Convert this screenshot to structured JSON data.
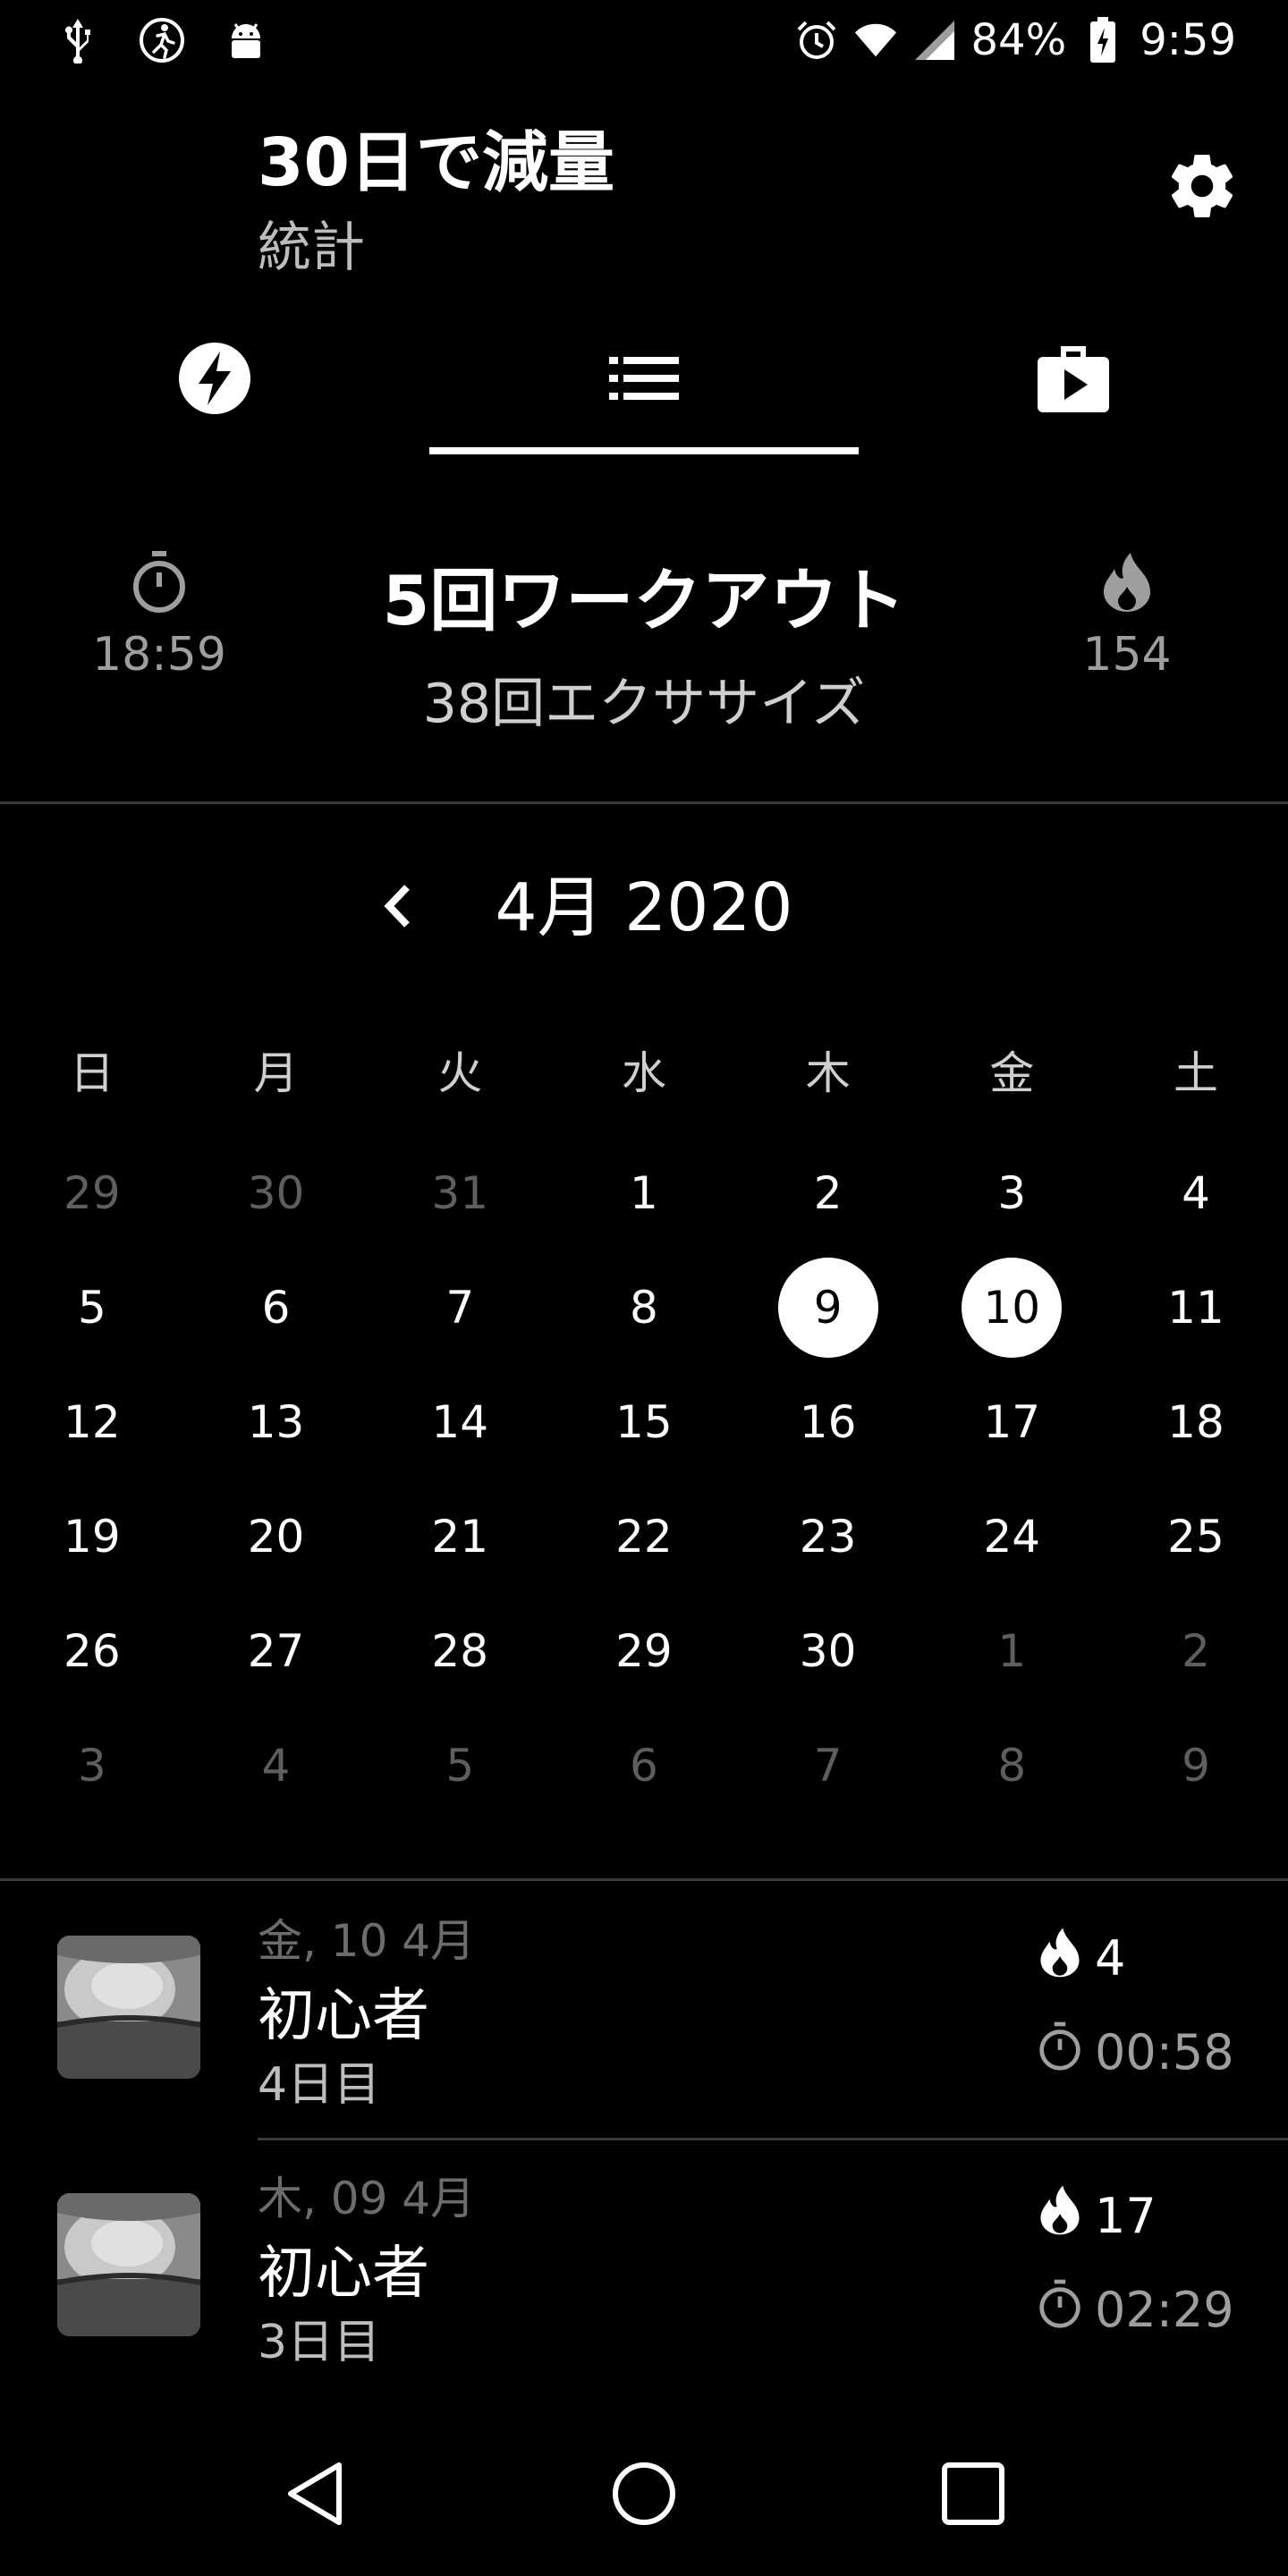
{
  "status_bar": {
    "battery": "84%",
    "time": "9:59",
    "left_icons": [
      "usb-icon",
      "running-icon",
      "android-icon"
    ],
    "right_icons": [
      "alarm-icon",
      "wifi-icon",
      "signal-icon",
      "battery-icon"
    ]
  },
  "header": {
    "title": "30日で減量",
    "subtitle": "統計",
    "settings_icon": "gear-icon"
  },
  "tabs": [
    {
      "icon": "lightning-icon",
      "selected": false
    },
    {
      "icon": "list-icon",
      "selected": true
    },
    {
      "icon": "video-briefcase-icon",
      "selected": false
    }
  ],
  "summary": {
    "time": "18:59",
    "workouts": "5回ワークアウト",
    "exercises": "38回エクササイズ",
    "calories": "154"
  },
  "calendar": {
    "month_label": "4月 2020",
    "weekdays": [
      "日",
      "月",
      "火",
      "水",
      "木",
      "金",
      "土"
    ],
    "weeks": [
      [
        {
          "d": "29",
          "o": true
        },
        {
          "d": "30",
          "o": true
        },
        {
          "d": "31",
          "o": true
        },
        {
          "d": "1"
        },
        {
          "d": "2"
        },
        {
          "d": "3"
        },
        {
          "d": "4"
        }
      ],
      [
        {
          "d": "5"
        },
        {
          "d": "6"
        },
        {
          "d": "7"
        },
        {
          "d": "8"
        },
        {
          "d": "9",
          "m": true
        },
        {
          "d": "10",
          "m": true
        },
        {
          "d": "11"
        }
      ],
      [
        {
          "d": "12"
        },
        {
          "d": "13"
        },
        {
          "d": "14"
        },
        {
          "d": "15"
        },
        {
          "d": "16"
        },
        {
          "d": "17"
        },
        {
          "d": "18"
        }
      ],
      [
        {
          "d": "19"
        },
        {
          "d": "20"
        },
        {
          "d": "21"
        },
        {
          "d": "22"
        },
        {
          "d": "23"
        },
        {
          "d": "24"
        },
        {
          "d": "25"
        }
      ],
      [
        {
          "d": "26"
        },
        {
          "d": "27"
        },
        {
          "d": "28"
        },
        {
          "d": "29"
        },
        {
          "d": "30"
        },
        {
          "d": "1",
          "o": true
        },
        {
          "d": "2",
          "o": true
        }
      ],
      [
        {
          "d": "3",
          "o": true
        },
        {
          "d": "4",
          "o": true
        },
        {
          "d": "5",
          "o": true
        },
        {
          "d": "6",
          "o": true
        },
        {
          "d": "7",
          "o": true
        },
        {
          "d": "8",
          "o": true
        },
        {
          "d": "9",
          "o": true
        }
      ]
    ]
  },
  "history": [
    {
      "date": "金, 10 4月",
      "name": "初心者",
      "day": "4日目",
      "calories": "4",
      "duration": "00:58"
    },
    {
      "date": "木, 09 4月",
      "name": "初心者",
      "day": "3日目",
      "calories": "17",
      "duration": "02:29"
    }
  ]
}
